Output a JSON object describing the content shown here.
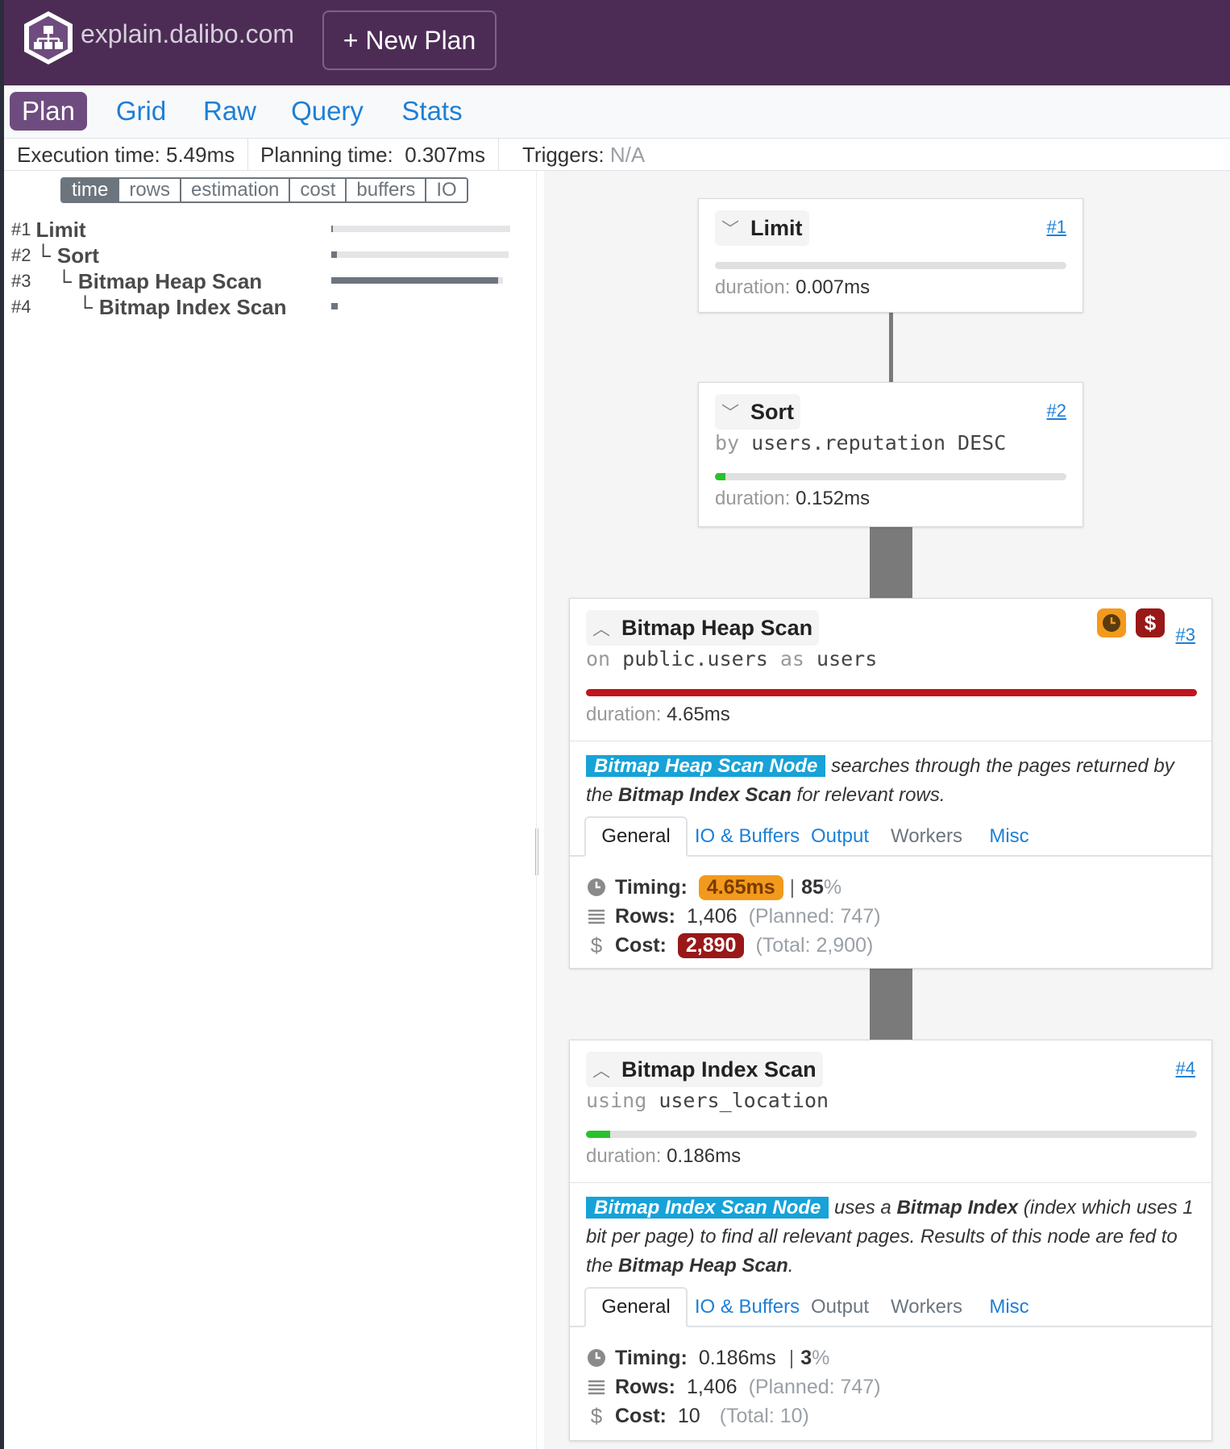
{
  "header": {
    "brand": "explain.dalibo.com",
    "new_plan_label": "+ New Plan"
  },
  "tabs": [
    {
      "label": "Plan",
      "active": true
    },
    {
      "label": "Grid",
      "active": false
    },
    {
      "label": "Raw",
      "active": false
    },
    {
      "label": "Query",
      "active": false
    },
    {
      "label": "Stats",
      "active": false
    }
  ],
  "stats": {
    "execution_label": "Execution time:",
    "execution_value": "5.49ms",
    "planning_label": "Planning time:",
    "planning_value": "0.307ms",
    "triggers_label": "Triggers:",
    "triggers_value": "N/A"
  },
  "metric_buttons": [
    {
      "label": "time",
      "active": true
    },
    {
      "label": "rows",
      "active": false
    },
    {
      "label": "estimation",
      "active": false
    },
    {
      "label": "cost",
      "active": false
    },
    {
      "label": "buffers",
      "active": false
    },
    {
      "label": "IO",
      "active": false
    }
  ],
  "tree": [
    {
      "num": "#1",
      "branch": "",
      "name": "Limit",
      "time_fraction": 0.01
    },
    {
      "num": "#2",
      "branch": "└",
      "name": "Sort",
      "time_fraction": 0.03
    },
    {
      "num": "#3",
      "branch": "└",
      "name": "Bitmap Heap Scan",
      "time_fraction": 0.97
    },
    {
      "num": "#4",
      "branch": "└",
      "name": "Bitmap Index Scan",
      "time_fraction": 0.04
    }
  ],
  "nodes": {
    "limit": {
      "title": "Limit",
      "link": "#1",
      "duration_label": "duration:",
      "duration_value": "0.007ms",
      "bar_fraction": 0.0,
      "bar_color": "#28a745"
    },
    "sort": {
      "title": "Sort",
      "link": "#2",
      "sub_kw": "by",
      "sub_text": "users.reputation DESC",
      "duration_label": "duration:",
      "duration_value": "0.152ms",
      "bar_fraction": 0.03,
      "bar_color": "#28c22e"
    },
    "heap": {
      "title": "Bitmap Heap Scan",
      "link": "#3",
      "sub_kw1": "on",
      "sub_text1": "public.users",
      "sub_kw2": "as",
      "sub_text2": "users",
      "duration_label": "duration:",
      "duration_value": "4.65ms",
      "bar_fraction": 1.0,
      "bar_color": "#c0161c",
      "desc_highlight": "Bitmap Heap Scan Node",
      "desc_1": " searches through the pages returned by the ",
      "desc_bold": "Bitmap Index Scan",
      "desc_2": " for relevant rows.",
      "detail_tabs": [
        "General",
        "IO & Buffers",
        "Output",
        "Workers",
        "Misc"
      ],
      "timing_label": "Timing:",
      "timing_value": "4.65ms",
      "timing_pct": "85",
      "pct_sign": "%",
      "rows_label": "Rows:",
      "rows_value": "1,406",
      "rows_planned": "(Planned: 747)",
      "cost_label": "Cost:",
      "cost_value": "2,890",
      "cost_total": "(Total: 2,900)"
    },
    "index": {
      "title": "Bitmap Index Scan",
      "link": "#4",
      "sub_kw": "using",
      "sub_text": "users_location",
      "duration_label": "duration:",
      "duration_value": "0.186ms",
      "bar_fraction": 0.04,
      "bar_color": "#28c22e",
      "desc_highlight": "Bitmap Index Scan Node",
      "desc_1": " uses a ",
      "desc_bold": "Bitmap Index",
      "desc_2": " (index which uses 1 bit per page) to find all relevant pages. Results of this node are fed to the ",
      "desc_bold2": "Bitmap Heap Scan",
      "desc_3": ".",
      "detail_tabs": [
        "General",
        "IO & Buffers",
        "Output",
        "Workers",
        "Misc"
      ],
      "timing_label": "Timing:",
      "timing_value": "0.186ms",
      "timing_pct": "3",
      "pct_sign": "%",
      "rows_label": "Rows:",
      "rows_value": "1,406",
      "rows_planned": "(Planned: 747)",
      "cost_label": "Cost:",
      "cost_value": "10",
      "cost_total": "(Total: 10)"
    }
  },
  "colors": {
    "header_bg": "#4c2c55",
    "accent_purple": "#6f4c7f",
    "link_blue": "#1d7fd6",
    "highlight_cyan": "#17a2d8",
    "warn_orange": "#f29a1d",
    "danger_red": "#991818"
  }
}
